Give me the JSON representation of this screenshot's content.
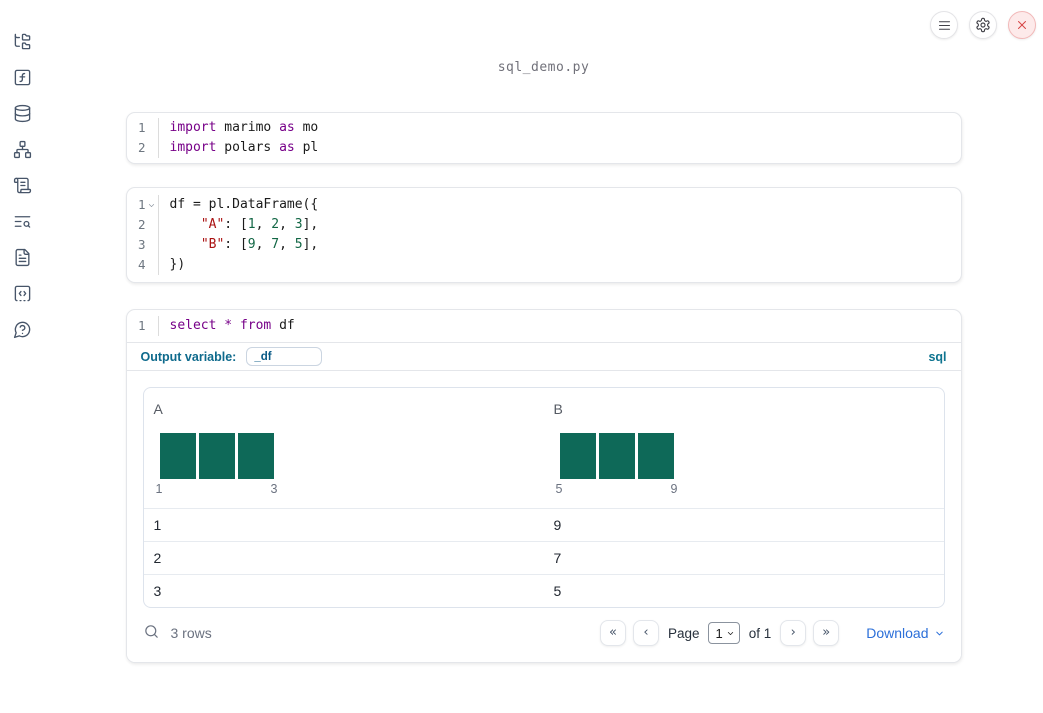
{
  "colors": {
    "histogram_bar": "#0e6958",
    "accent_blue": "#2b6fd9",
    "label_teal": "#0e6a8c",
    "keyword": "#770088",
    "string": "#aa1111",
    "number": "#116644"
  },
  "header": {
    "filename": "sql_demo.py"
  },
  "topbar": {
    "buttons": [
      {
        "icon": "menu-icon"
      },
      {
        "icon": "gear-icon"
      },
      {
        "icon": "shutdown-icon"
      }
    ]
  },
  "sidebar": {
    "items": [
      {
        "icon": "file-explorer-icon"
      },
      {
        "icon": "variables-icon"
      },
      {
        "icon": "datasources-icon"
      },
      {
        "icon": "dependency-graph-icon"
      },
      {
        "icon": "outline-icon"
      },
      {
        "icon": "logs-icon"
      },
      {
        "icon": "documentation-icon"
      },
      {
        "icon": "snippets-icon"
      },
      {
        "icon": "help-icon"
      }
    ]
  },
  "cells": [
    {
      "lines": [
        {
          "num": "1",
          "tokens": [
            [
              "kw",
              "import"
            ],
            [
              "pl",
              " marimo "
            ],
            [
              "kw",
              "as"
            ],
            [
              "pl",
              " mo"
            ]
          ]
        },
        {
          "num": "2",
          "tokens": [
            [
              "kw",
              "import"
            ],
            [
              "pl",
              " polars "
            ],
            [
              "kw",
              "as"
            ],
            [
              "pl",
              " pl"
            ]
          ]
        }
      ]
    },
    {
      "lines": [
        {
          "num": "1",
          "fold": true,
          "tokens": [
            [
              "pl",
              "df = pl.DataFrame({"
            ]
          ]
        },
        {
          "num": "2",
          "tokens": [
            [
              "pl",
              "    "
            ],
            [
              "str",
              "\"A\""
            ],
            [
              "pl",
              ": ["
            ],
            [
              "num",
              "1"
            ],
            [
              "pl",
              ", "
            ],
            [
              "num",
              "2"
            ],
            [
              "pl",
              ", "
            ],
            [
              "num",
              "3"
            ],
            [
              "pl",
              "],"
            ]
          ]
        },
        {
          "num": "3",
          "tokens": [
            [
              "pl",
              "    "
            ],
            [
              "str",
              "\"B\""
            ],
            [
              "pl",
              ": ["
            ],
            [
              "num",
              "9"
            ],
            [
              "pl",
              ", "
            ],
            [
              "num",
              "7"
            ],
            [
              "pl",
              ", "
            ],
            [
              "num",
              "5"
            ],
            [
              "pl",
              "],"
            ]
          ]
        },
        {
          "num": "4",
          "tokens": [
            [
              "pl",
              "})"
            ]
          ]
        }
      ]
    },
    {
      "lines": [
        {
          "num": "1",
          "tokens": [
            [
              "kw",
              "select"
            ],
            [
              "pl",
              " "
            ],
            [
              "kw",
              "*"
            ],
            [
              "pl",
              " "
            ],
            [
              "kw",
              "from"
            ],
            [
              "pl",
              " df"
            ]
          ]
        }
      ],
      "footer": {
        "label": "Output variable:",
        "variable": "_df",
        "language": "sql"
      }
    }
  ],
  "table": {
    "columns": [
      {
        "name": "A",
        "histogram": {
          "values": [
            1,
            1,
            1
          ],
          "min_label": "1",
          "max_label": "3"
        }
      },
      {
        "name": "B",
        "histogram": {
          "values": [
            1,
            1,
            1
          ],
          "min_label": "5",
          "max_label": "9"
        }
      }
    ],
    "rows": [
      [
        "1",
        "9"
      ],
      [
        "2",
        "7"
      ],
      [
        "3",
        "5"
      ]
    ],
    "footer": {
      "row_count": "3 rows",
      "page_label": "Page",
      "page_value": "1",
      "page_total": "of 1",
      "first_button": "«",
      "prev_button": "‹",
      "next_button": "›",
      "last_button": "»",
      "download_label": "Download"
    }
  }
}
